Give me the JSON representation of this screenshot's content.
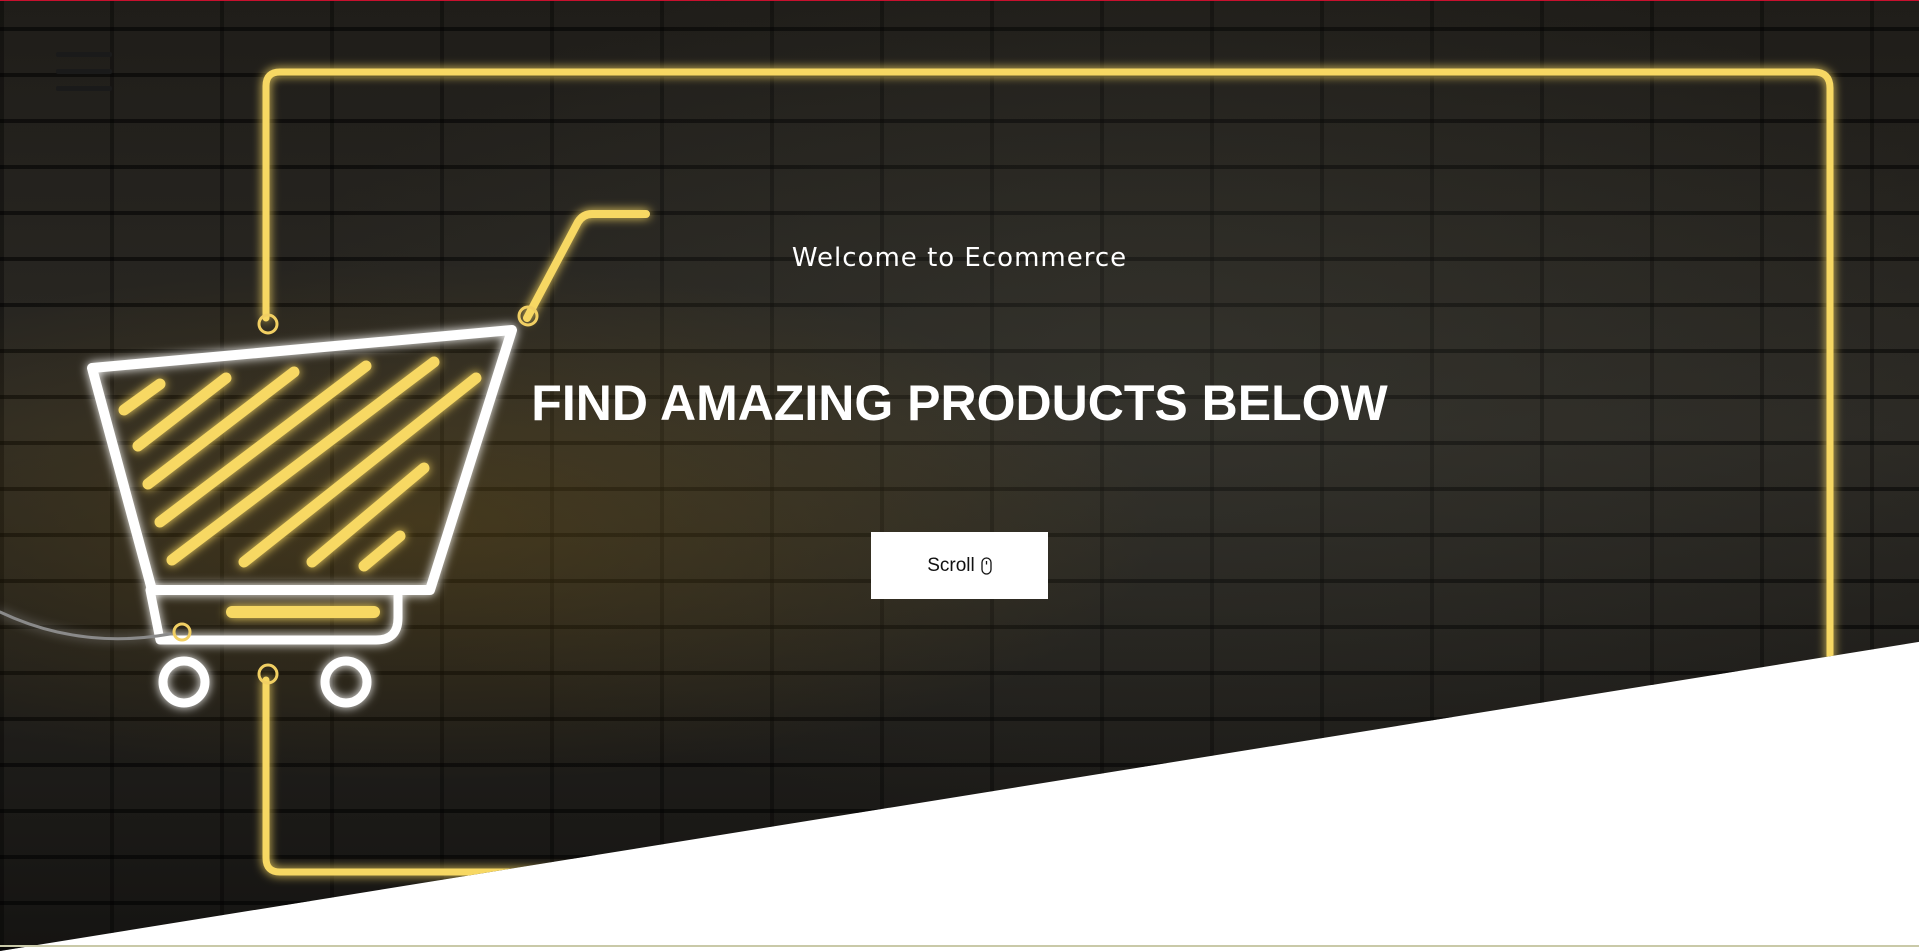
{
  "hero": {
    "welcome": "Welcome to Ecommerce",
    "headline": "FIND AMAZING PRODUCTS BELOW",
    "scroll_label": "Scroll"
  },
  "icons": {
    "menu": "hamburger-menu-icon",
    "scroll": "mouse-icon",
    "cart": "shopping-cart-neon"
  },
  "colors": {
    "neon": "#f7d864",
    "neon_glow": "#e8b62a",
    "hero_text": "#ffffff",
    "button_bg": "#ffffff",
    "button_text": "#111111",
    "top_edge": "#c8102e"
  }
}
